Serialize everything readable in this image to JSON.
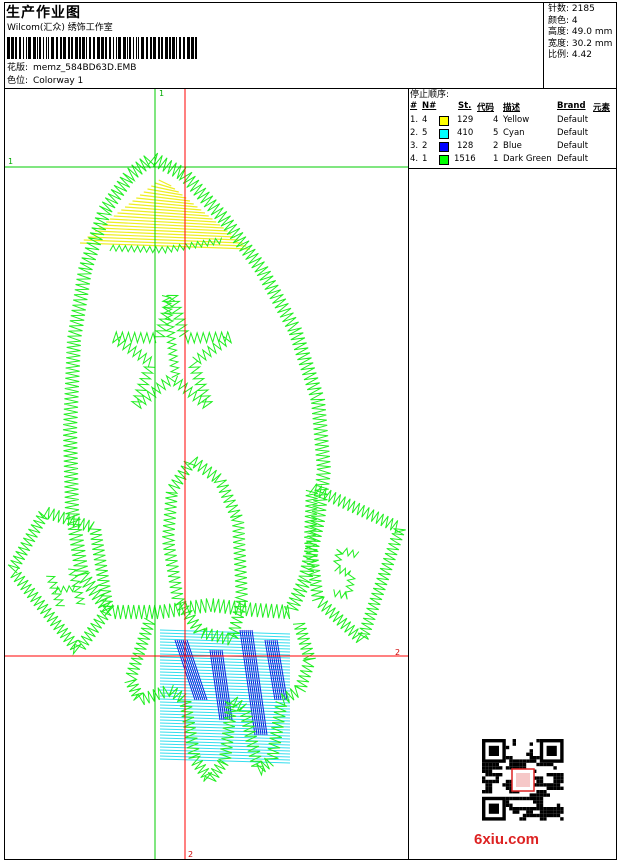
{
  "header": {
    "title": "生产作业图",
    "company": "Wilcom(汇众) 绣饰工作室",
    "design_label": "花版:",
    "design_file": "memz_584BD63D.EMB",
    "colorway_label": "色位:",
    "colorway": "Colorway 1"
  },
  "specs": [
    {
      "label": "针数:",
      "value": "2185"
    },
    {
      "label": "颜色:",
      "value": "4"
    },
    {
      "label": "高度:",
      "value": "49.0 mm"
    },
    {
      "label": "宽度:",
      "value": "30.2 mm"
    },
    {
      "label": "比例:",
      "value": "4.42"
    }
  ],
  "color_table": {
    "heading": "停止顺序:",
    "columns": [
      "#",
      "N#",
      "St.",
      "代码",
      "描述",
      "Brand",
      "元素"
    ],
    "rows": [
      {
        "idx": "1.",
        "n": "4",
        "color": "#ffff00",
        "st": "129",
        "code": "4",
        "desc": "Yellow",
        "brand": "Default"
      },
      {
        "idx": "2.",
        "n": "5",
        "color": "#00ffff",
        "st": "410",
        "code": "5",
        "desc": "Cyan",
        "brand": "Default"
      },
      {
        "idx": "3.",
        "n": "2",
        "color": "#0000ff",
        "st": "128",
        "code": "2",
        "desc": "Blue",
        "brand": "Default"
      },
      {
        "idx": "4.",
        "n": "1",
        "color": "#00ff00",
        "st": "1516",
        "code": "1",
        "desc": "Dark Green",
        "brand": "Default"
      }
    ]
  },
  "guides": {
    "v_green": "1",
    "h_green": "1",
    "h_red": "2",
    "v_red": "2"
  },
  "watermark": {
    "site": "6xiu.com"
  },
  "colors": {
    "thread_green": "#22ee22",
    "thread_yellow": "#eeee22",
    "thread_cyan": "#33ddee",
    "thread_blue": "#1122dd",
    "guide_green": "#00cc00",
    "guide_red": "#ff0000",
    "logo_red": "#dd2222"
  }
}
